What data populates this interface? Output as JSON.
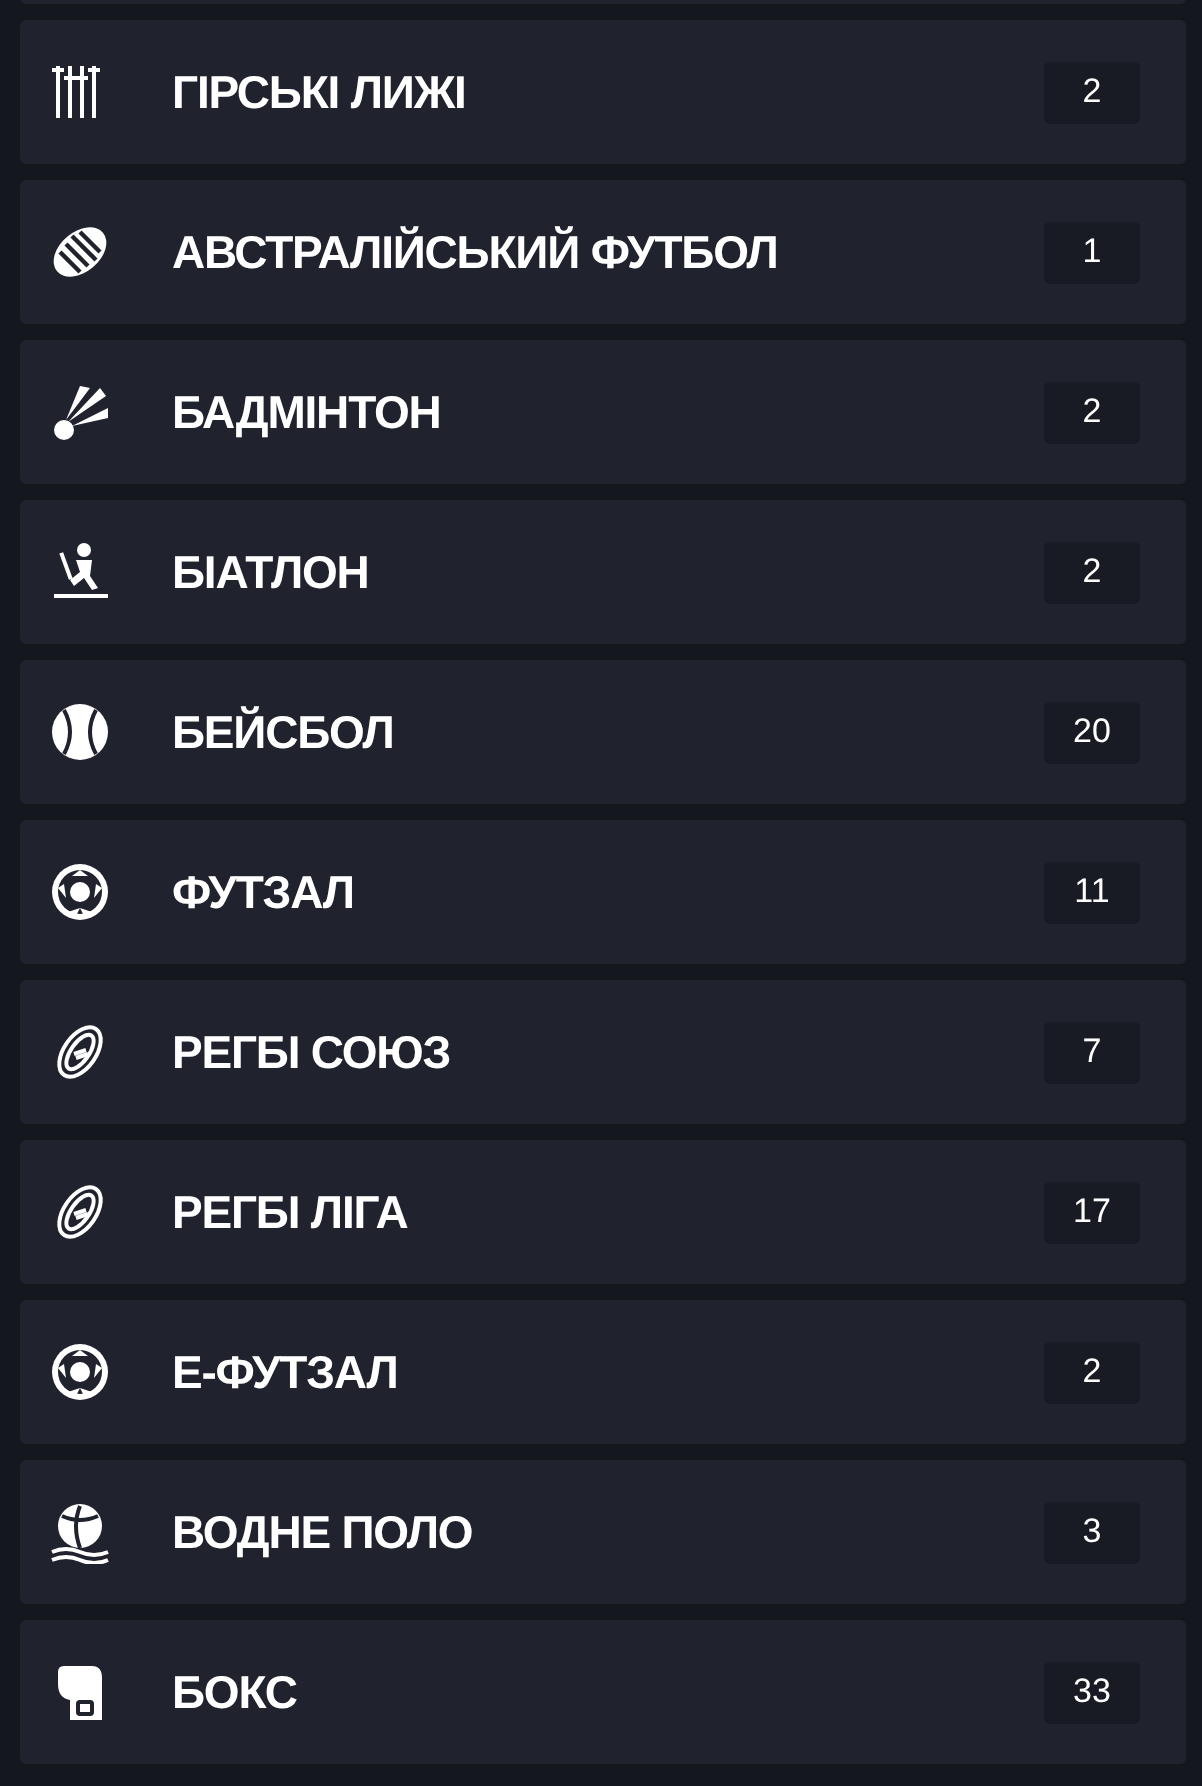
{
  "sports": [
    {
      "kind": "skis",
      "name": "ГІРСЬКІ ЛИЖІ",
      "count": "2"
    },
    {
      "kind": "aussie-ball",
      "name": "АВСТРАЛІЙСЬКИЙ ФУТБОЛ",
      "count": "1"
    },
    {
      "kind": "shuttlecock",
      "name": "БАДМІНТОН",
      "count": "2"
    },
    {
      "kind": "biathlon",
      "name": "БІАТЛОН",
      "count": "2"
    },
    {
      "kind": "baseball",
      "name": "БЕЙСБОЛ",
      "count": "20"
    },
    {
      "kind": "soccer",
      "name": "ФУТЗАЛ",
      "count": "11"
    },
    {
      "kind": "rugby",
      "name": "РЕГБІ СОЮЗ",
      "count": "7"
    },
    {
      "kind": "rugby",
      "name": "РЕГБІ ЛІГА",
      "count": "17"
    },
    {
      "kind": "soccer",
      "name": "Е-ФУТЗАЛ",
      "count": "2"
    },
    {
      "kind": "water-polo",
      "name": "ВОДНЕ ПОЛО",
      "count": "3"
    },
    {
      "kind": "boxing",
      "name": "БОКС",
      "count": "33"
    }
  ]
}
